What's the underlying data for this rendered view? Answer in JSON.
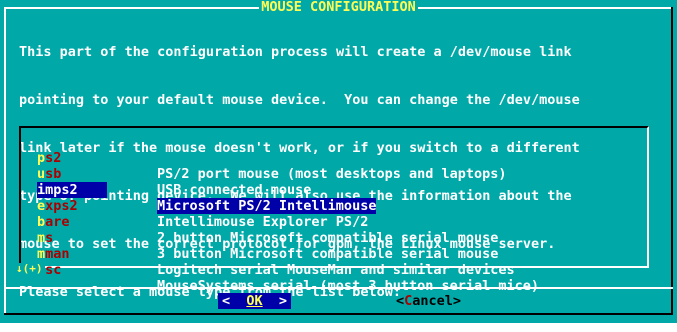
{
  "dialog": {
    "title": "MOUSE CONFIGURATION",
    "intro_lines": [
      "This part of the configuration process will create a /dev/mouse link",
      "pointing to your default mouse device.  You can change the /dev/mouse",
      "link later if the mouse doesn't work, or if you switch to a different",
      "type of pointing device.  We will also use the information about the",
      "mouse to set the correct protocol for gpm, the Linux mouse server.",
      "Please select a mouse type from the list below:"
    ]
  },
  "list": {
    "items": [
      {
        "hot": "p",
        "rest": "s2",
        "description": "PS/2 port mouse (most desktops and laptops)",
        "selected": false
      },
      {
        "hot": "u",
        "rest": "sb",
        "description": "USB connected mouse",
        "selected": false
      },
      {
        "hot": "i",
        "rest": "mps2",
        "description": "Microsoft PS/2 Intellimouse",
        "selected": true
      },
      {
        "hot": "e",
        "rest": "xps2",
        "description": "Intellimouse Explorer PS/2",
        "selected": false
      },
      {
        "hot": "b",
        "rest": "are",
        "description": "2 button Microsoft compatible serial mouse",
        "selected": false
      },
      {
        "hot": "m",
        "rest": "s",
        "description": "3 button Microsoft compatible serial mouse",
        "selected": false
      },
      {
        "hot": "m",
        "rest": "man",
        "description": "Logitech serial MouseMan and similar devices",
        "selected": false
      },
      {
        "hot": "m",
        "rest": "sc",
        "description": "MouseSystems serial (most 3 button serial mice)",
        "selected": false
      }
    ],
    "scroll_indicator": "↓(+)"
  },
  "buttons": {
    "ok": {
      "left": "<  ",
      "hot": "OK",
      "right": "  >"
    },
    "cancel": {
      "left": "<",
      "hot": "C",
      "rest": "ancel",
      "right": ">"
    }
  },
  "colors": {
    "dialog_bg": "#00a8a8",
    "title": "#ffff55",
    "text": "#ffffff",
    "hotkey": "#ffff55",
    "tag": "#aa0000",
    "selection_bg": "#0000a8"
  }
}
